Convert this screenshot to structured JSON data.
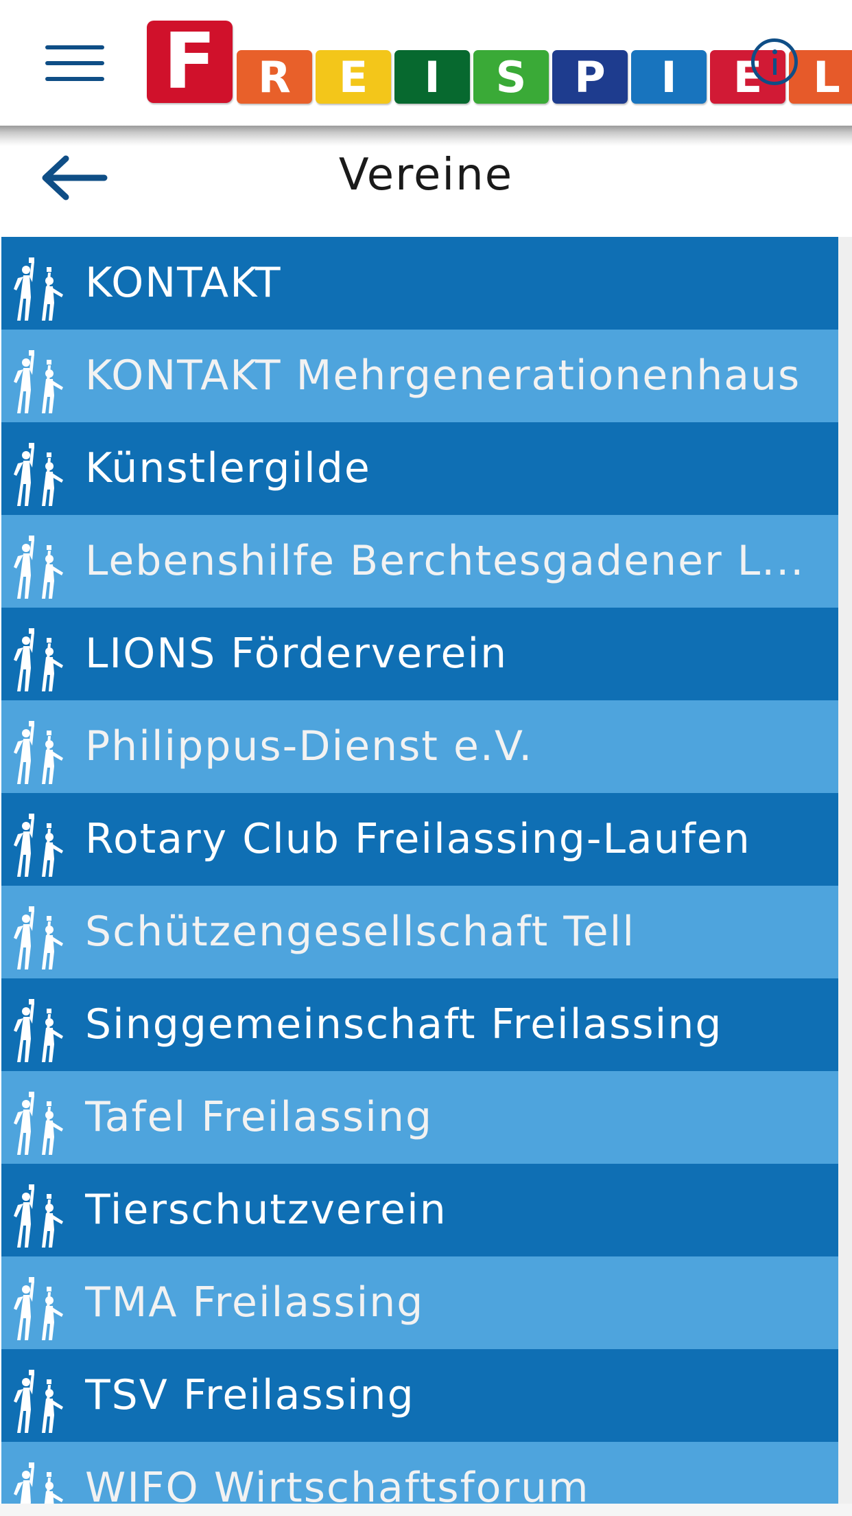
{
  "app": {
    "logo_text": "FREISPIEL",
    "logo_letters": [
      {
        "char": "F",
        "color": "#d0112b"
      },
      {
        "char": "R",
        "color": "#e8602a"
      },
      {
        "char": "E",
        "color": "#f3c61a"
      },
      {
        "char": "I",
        "color": "#07692f"
      },
      {
        "char": "S",
        "color": "#3aaa37"
      },
      {
        "char": "P",
        "color": "#1e3c8e"
      },
      {
        "char": "I",
        "color": "#1874be"
      },
      {
        "char": "E",
        "color": "#d11a35"
      },
      {
        "char": "L",
        "color": "#e65a2a"
      }
    ],
    "menu_icon": "hamburger-menu-icon",
    "info_icon": "info-icon"
  },
  "header": {
    "title": "Vereine",
    "back_icon": "arrow-left-icon"
  },
  "list": {
    "item_icon": "people-group-icon",
    "items": [
      {
        "label": "KONTAKT"
      },
      {
        "label": "KONTAKT Mehrgenerationenhaus"
      },
      {
        "label": "Künstlergilde"
      },
      {
        "label": "Lebenshilfe Berchtesgadener L..."
      },
      {
        "label": "LIONS Förderverein"
      },
      {
        "label": "Philippus-Dienst e.V."
      },
      {
        "label": "Rotary Club Freilassing-Laufen"
      },
      {
        "label": "Schützengesellschaft Tell"
      },
      {
        "label": "Singgemeinschaft Freilassing"
      },
      {
        "label": "Tafel Freilassing"
      },
      {
        "label": "Tierschutzverein"
      },
      {
        "label": "TMA Freilassing"
      },
      {
        "label": "TSV Freilassing"
      },
      {
        "label": "WIFO Wirtschaftsforum"
      }
    ]
  },
  "colors": {
    "row_dark": "#0f6fb4",
    "row_light": "#4ea4dd",
    "icon_blue": "#0f4e86"
  }
}
